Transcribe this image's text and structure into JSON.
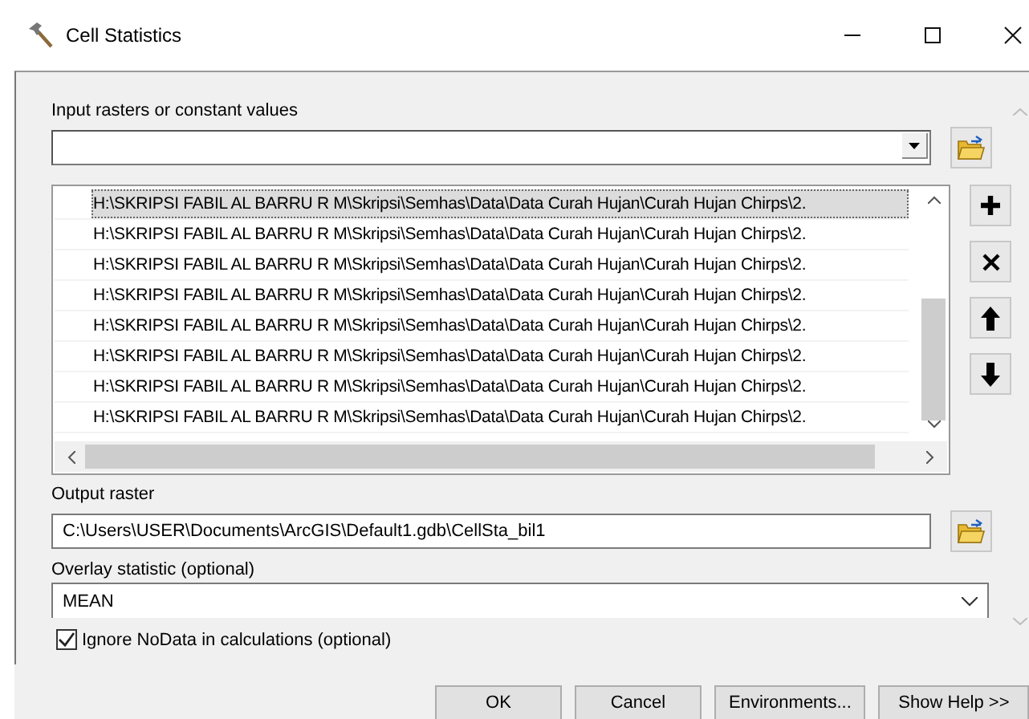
{
  "window": {
    "title": "Cell Statistics"
  },
  "input_rasters": {
    "label": "Input rasters or constant values",
    "items": [
      {
        "text": "H:\\SKRIPSI FABIL AL BARRU R M\\Skripsi\\Semhas\\Data\\Data Curah Hujan\\Curah Hujan Chirps\\2.",
        "selected": true
      },
      {
        "text": "H:\\SKRIPSI FABIL AL BARRU R M\\Skripsi\\Semhas\\Data\\Data Curah Hujan\\Curah Hujan Chirps\\2.",
        "selected": false
      },
      {
        "text": "H:\\SKRIPSI FABIL AL BARRU R M\\Skripsi\\Semhas\\Data\\Data Curah Hujan\\Curah Hujan Chirps\\2.",
        "selected": false
      },
      {
        "text": "H:\\SKRIPSI FABIL AL BARRU R M\\Skripsi\\Semhas\\Data\\Data Curah Hujan\\Curah Hujan Chirps\\2.",
        "selected": false
      },
      {
        "text": "H:\\SKRIPSI FABIL AL BARRU R M\\Skripsi\\Semhas\\Data\\Data Curah Hujan\\Curah Hujan Chirps\\2.",
        "selected": false
      },
      {
        "text": "H:\\SKRIPSI FABIL AL BARRU R M\\Skripsi\\Semhas\\Data\\Data Curah Hujan\\Curah Hujan Chirps\\2.",
        "selected": false
      },
      {
        "text": "H:\\SKRIPSI FABIL AL BARRU R M\\Skripsi\\Semhas\\Data\\Data Curah Hujan\\Curah Hujan Chirps\\2.",
        "selected": false
      },
      {
        "text": "H:\\SKRIPSI FABIL AL BARRU R M\\Skripsi\\Semhas\\Data\\Data Curah Hujan\\Curah Hujan Chirps\\2.",
        "selected": false
      }
    ]
  },
  "output_raster": {
    "label": "Output raster",
    "value": "C:\\Users\\USER\\Documents\\ArcGIS\\Default1.gdb\\CellSta_bil1"
  },
  "overlay_statistic": {
    "label": "Overlay statistic (optional)",
    "value": "MEAN"
  },
  "ignore_nodata": {
    "label": "Ignore NoData in calculations (optional)",
    "checked": true
  },
  "buttons": [
    "OK",
    "Cancel",
    "Environments...",
    "Show Help >>"
  ]
}
